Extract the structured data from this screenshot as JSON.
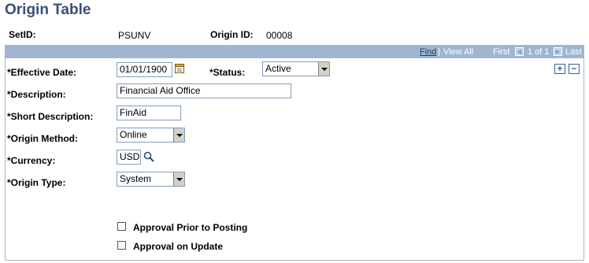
{
  "page": {
    "title": "Origin Table"
  },
  "header": {
    "setid_label": "SetID:",
    "setid_value": "PSUNV",
    "origin_id_label": "Origin ID:",
    "origin_id_value": "00008"
  },
  "nav": {
    "find": "Find",
    "sep": "|",
    "view_all": "View All",
    "first": "First",
    "range": "1 of 1",
    "last": "Last"
  },
  "form": {
    "effective_date_label": "*Effective Date:",
    "effective_date_value": "01/01/1900",
    "status_label": "*Status:",
    "status_value": "Active",
    "description_label": "*Description:",
    "description_value": "Financial Aid Office",
    "short_desc_label": "*Short Description:",
    "short_desc_value": "FinAid",
    "origin_method_label": "*Origin Method:",
    "origin_method_value": "Online",
    "currency_label": "*Currency:",
    "currency_value": "USD",
    "origin_type_label": "*Origin Type:",
    "origin_type_value": "System",
    "approval_prior_label": "Approval Prior to Posting",
    "approval_update_label": "Approval on Update"
  },
  "icons": {
    "calendar": "calendar-icon",
    "lookup": "magnifier-icon",
    "add": "plus-icon",
    "remove": "minus-icon",
    "prev": "left-arrow-icon",
    "next": "right-arrow-icon"
  },
  "colors": {
    "title": "#3b4d7d",
    "nav_bar": "#a0b6d0"
  }
}
